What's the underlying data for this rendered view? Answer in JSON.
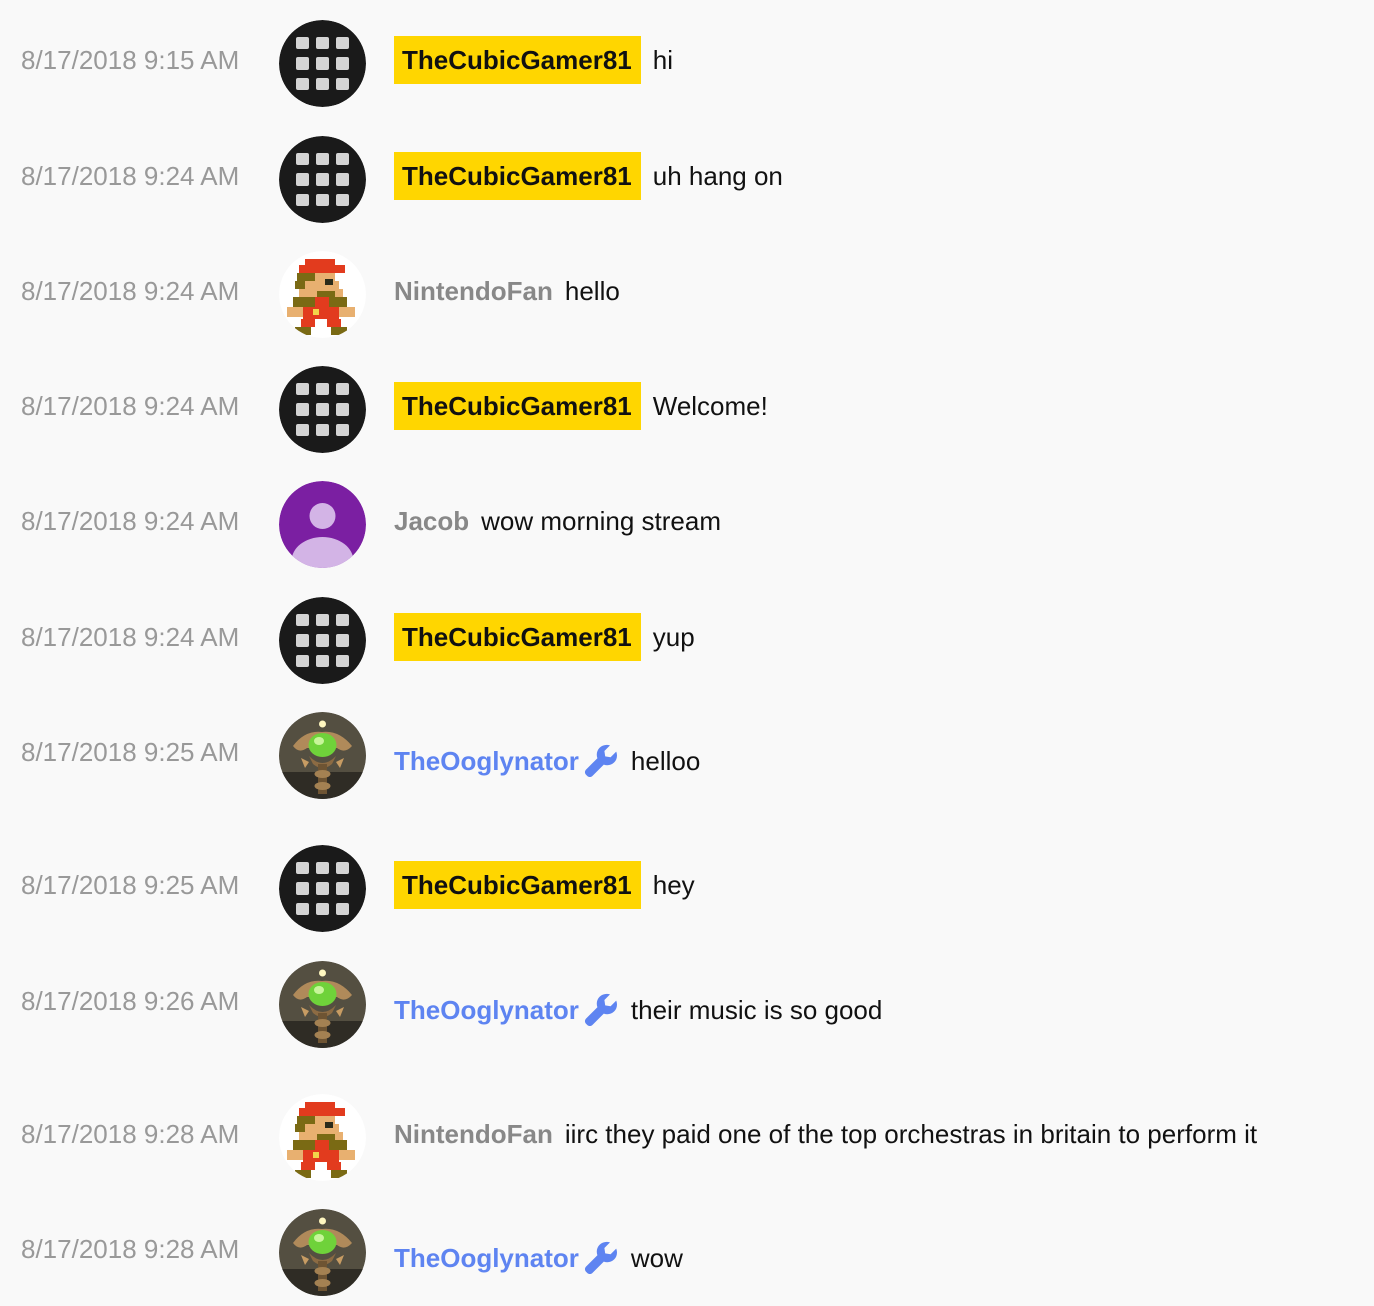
{
  "colors": {
    "background": "#f9f9f9",
    "timestamp": "#999999",
    "owner_badge": "#ffd600",
    "moderator": "#5e84f1",
    "member": "#888888"
  },
  "messages": [
    {
      "timestamp": "8/17/2018 9:15 AM",
      "author": "TheCubicGamer81",
      "role": "owner",
      "avatar": "grid-avatar",
      "text": "hi"
    },
    {
      "timestamp": "8/17/2018 9:24 AM",
      "author": "TheCubicGamer81",
      "role": "owner",
      "avatar": "grid-avatar",
      "text": "uh hang on"
    },
    {
      "timestamp": "8/17/2018 9:24 AM",
      "author": "NintendoFan",
      "role": "viewer",
      "avatar": "pixel-mario-avatar",
      "text": "hello"
    },
    {
      "timestamp": "8/17/2018 9:24 AM",
      "author": "TheCubicGamer81",
      "role": "owner",
      "avatar": "grid-avatar",
      "text": "Welcome!"
    },
    {
      "timestamp": "8/17/2018 9:24 AM",
      "author": "Jacob",
      "role": "viewer",
      "avatar": "default-person-avatar",
      "text": "wow morning stream"
    },
    {
      "timestamp": "8/17/2018 9:24 AM",
      "author": "TheCubicGamer81",
      "role": "owner",
      "avatar": "grid-avatar",
      "text": "yup"
    },
    {
      "timestamp": "8/17/2018 9:25 AM",
      "author": "TheOoglynator",
      "role": "moderator",
      "avatar": "green-orb-avatar",
      "badge_icon": "wrench-icon",
      "text": "helloo"
    },
    {
      "timestamp": "8/17/2018 9:25 AM",
      "author": "TheCubicGamer81",
      "role": "owner",
      "avatar": "grid-avatar",
      "text": "hey"
    },
    {
      "timestamp": "8/17/2018 9:26 AM",
      "author": "TheOoglynator",
      "role": "moderator",
      "avatar": "green-orb-avatar",
      "badge_icon": "wrench-icon",
      "text": "their music is so good"
    },
    {
      "timestamp": "8/17/2018 9:28 AM",
      "author": "NintendoFan",
      "role": "viewer",
      "avatar": "pixel-mario-avatar",
      "text": "iirc they paid one of the top orchestras in britain to perform it"
    },
    {
      "timestamp": "8/17/2018 9:28 AM",
      "author": "TheOoglynator",
      "role": "moderator",
      "avatar": "green-orb-avatar",
      "badge_icon": "wrench-icon",
      "text": "wow"
    }
  ]
}
